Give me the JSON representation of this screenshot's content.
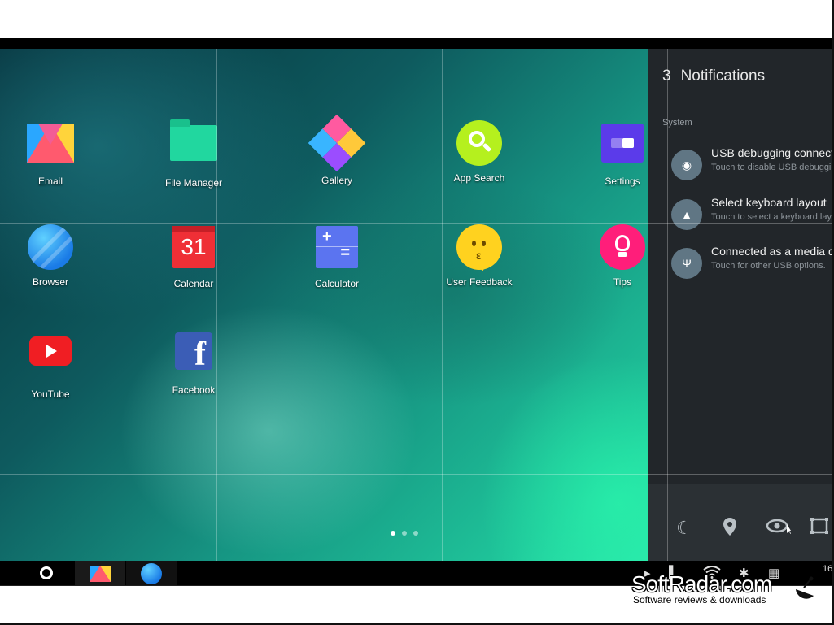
{
  "desktop": {
    "apps": [
      {
        "label": "Email",
        "icon": "email-icon"
      },
      {
        "label": "File Manager",
        "icon": "folder-icon"
      },
      {
        "label": "Gallery",
        "icon": "gallery-icon"
      },
      {
        "label": "App Search",
        "icon": "search-icon"
      },
      {
        "label": "Settings",
        "icon": "settings-icon"
      },
      {
        "label": "Browser",
        "icon": "browser-icon"
      },
      {
        "label": "Calendar",
        "icon": "calendar-icon",
        "glyph": "31"
      },
      {
        "label": "Calculator",
        "icon": "calculator-icon"
      },
      {
        "label": "User Feedback",
        "icon": "feedback-icon"
      },
      {
        "label": "Tips",
        "icon": "lightbulb-icon"
      },
      {
        "label": "YouTube",
        "icon": "youtube-icon"
      },
      {
        "label": "Facebook",
        "icon": "facebook-icon",
        "glyph": "f"
      }
    ],
    "page_count": 3,
    "active_page": 1
  },
  "notifications": {
    "count": "3",
    "title": "Notifications",
    "section": "System",
    "items": [
      {
        "title": "USB debugging connected",
        "subtitle": "Touch to disable USB debugging.",
        "icon": "android-icon"
      },
      {
        "title": "Select keyboard layout",
        "subtitle": "Touch to select a keyboard layout.",
        "icon": "keyboard-icon"
      },
      {
        "title": "Connected as a media device",
        "subtitle": "Touch for other USB options.",
        "icon": "usb-icon"
      }
    ]
  },
  "quick_settings": [
    "moon-icon",
    "location-icon",
    "eye-icon",
    "screen-icon"
  ],
  "taskbar": {
    "running_apps": [
      "email-icon",
      "browser-icon"
    ],
    "clock": "16"
  },
  "watermark": {
    "logo": "SoftRadar.com",
    "tagline": "Software reviews & downloads"
  },
  "colors": {
    "notif_bg": "#22262a",
    "quick_settings_bg": "#2b3034",
    "wallpaper_accent": "#2ef0b0"
  }
}
